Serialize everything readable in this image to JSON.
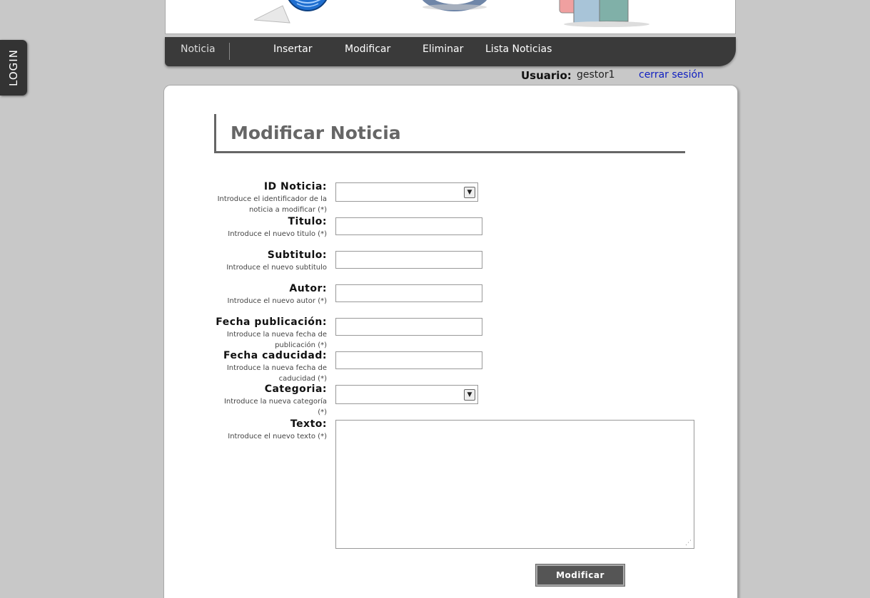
{
  "login_tab": {
    "label": "LOGIN"
  },
  "nav": {
    "section": "Noticia",
    "items": [
      "Insertar",
      "Modificar",
      "Eliminar",
      "Lista Noticias"
    ]
  },
  "user": {
    "label": "Usuario:",
    "name": "gestor1",
    "logout": "cerrar sesión"
  },
  "form": {
    "title": "Modificar Noticia",
    "fields": [
      {
        "label": "ID Noticia:",
        "help": "Introduce el identificador de la noticia a modificar (*)",
        "type": "select",
        "value": ""
      },
      {
        "label": "Titulo:",
        "help": "Introduce el nuevo titulo (*)",
        "type": "text",
        "value": ""
      },
      {
        "label": "Subtitulo:",
        "help": "Introduce el nuevo subtitulo",
        "type": "text",
        "value": ""
      },
      {
        "label": "Autor:",
        "help": "Introduce el nuevo autor (*)",
        "type": "text",
        "value": ""
      },
      {
        "label": "Fecha publicación:",
        "help": "Introduce la nueva fecha de publicación (*)",
        "type": "text",
        "value": ""
      },
      {
        "label": "Fecha caducidad:",
        "help": "Introduce la nueva fecha de caducidad (*)",
        "type": "text",
        "value": ""
      },
      {
        "label": "Categoria:",
        "help": "Introduce la nueva categoría (*)",
        "type": "select",
        "value": ""
      },
      {
        "label": "Texto:",
        "help": "Introduce el nuevo texto (*)",
        "type": "textarea",
        "value": ""
      }
    ],
    "submit": "Modificar"
  },
  "icons": [
    "globe-icon",
    "disc-icon",
    "books-icon",
    "chevron-down-icon",
    "resize-grip-icon"
  ],
  "colors": {
    "nav_bg": "#3a3a3a",
    "page_bg": "#c8c8c8",
    "title": "#666666",
    "link": "#1020c0",
    "button": "#555555"
  }
}
